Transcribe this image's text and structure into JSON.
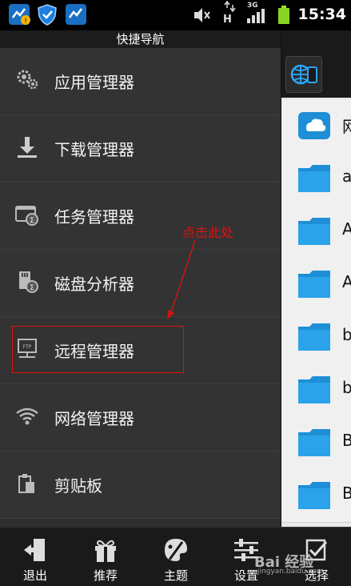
{
  "status_bar": {
    "time": "15:34",
    "network": "3G",
    "icons": [
      "sync-warning-icon",
      "shield-icon",
      "sync-icon",
      "mute-icon",
      "data-icon",
      "signal-icon",
      "battery-icon"
    ]
  },
  "drawer": {
    "title": "快捷导航",
    "items": [
      {
        "label": "应用管理器",
        "icon": "gears-icon"
      },
      {
        "label": "下载管理器",
        "icon": "download-icon"
      },
      {
        "label": "任务管理器",
        "icon": "task-icon"
      },
      {
        "label": "磁盘分析器",
        "icon": "disk-icon"
      },
      {
        "label": "远程管理器",
        "icon": "ftp-icon"
      },
      {
        "label": "网络管理器",
        "icon": "wifi-icon"
      },
      {
        "label": "剪贴板",
        "icon": "clipboard-icon"
      }
    ]
  },
  "annotation": {
    "text": "点击此处",
    "color": "#e01010"
  },
  "background_list": {
    "letters": [
      "网",
      "a",
      "A",
      "A",
      "b",
      "b",
      "B",
      "B"
    ]
  },
  "bottom_bar": {
    "buttons": [
      {
        "label": "退出",
        "icon": "exit-icon"
      },
      {
        "label": "推荐",
        "icon": "gift-icon"
      },
      {
        "label": "主题",
        "icon": "palette-icon"
      },
      {
        "label": "设置",
        "icon": "sliders-icon"
      },
      {
        "label": "选择",
        "icon": "select-icon"
      }
    ]
  },
  "watermark": {
    "text": "Bai 经验",
    "url": "jingyan.baidu.com"
  },
  "colors": {
    "accent_red": "#e01010",
    "folder_blue": "#1e8fd6",
    "drawer_bg": "#333333"
  }
}
